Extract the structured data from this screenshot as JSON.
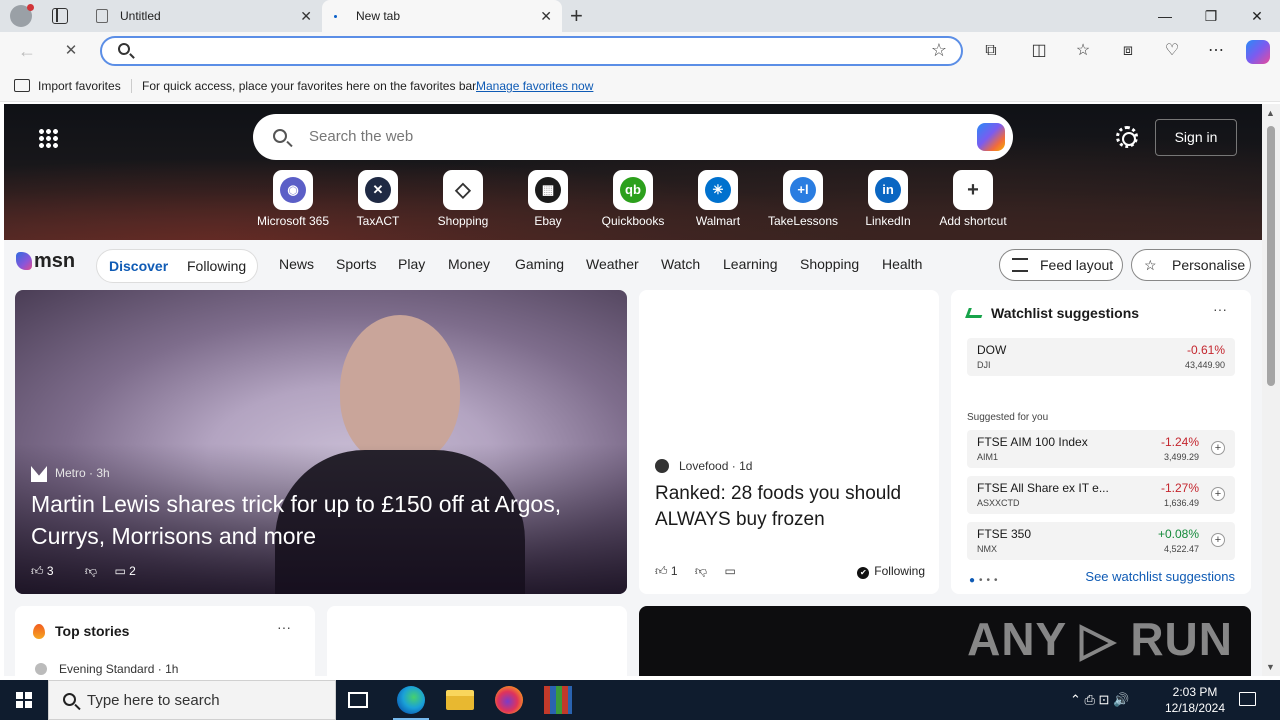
{
  "browser": {
    "tabs": [
      {
        "title": "Untitled"
      },
      {
        "title": "New tab"
      }
    ],
    "new_tab_glyph": "+",
    "close_glyph": "✕",
    "window_controls": {
      "minimize": "—",
      "restore": "❐",
      "close": "✕"
    },
    "address_value": "",
    "nav": {
      "back": "←",
      "stop": "✕"
    },
    "toolbar_icons": [
      "extensions-icon",
      "split-screen-icon",
      "favorites-icon",
      "collections-icon",
      "browser-essentials-icon",
      "more-icon",
      "copilot-icon"
    ],
    "toolbar_glyphs": {
      "extensions": "⧉",
      "split": "◫",
      "favorites": "☆",
      "collections": "⧈",
      "essentials": "♡",
      "more": "⋯",
      "star": "☆"
    }
  },
  "favorites_bar": {
    "import_label": "Import favorites",
    "message": "For quick access, place your favorites here on the favorites bar.",
    "manage_link": "Manage favorites now"
  },
  "newtab": {
    "search_placeholder": "Search the web",
    "sign_in": "Sign in",
    "shortcuts": [
      {
        "label": "Microsoft 365",
        "glyph": "◉",
        "color": "#5b5fc7"
      },
      {
        "label": "TaxACT",
        "glyph": "✕",
        "color": "#1f2a44"
      },
      {
        "label": "Shopping",
        "glyph": "◇",
        "color": "#ffffff"
      },
      {
        "label": "Ebay",
        "glyph": "▦",
        "color": "#1b1b1b"
      },
      {
        "label": "Quickbooks",
        "glyph": "qb",
        "color": "#2ca01c"
      },
      {
        "label": "Walmart",
        "glyph": "✳",
        "color": "#0071ce"
      },
      {
        "label": "TakeLessons",
        "glyph": "+l",
        "color": "#2a7de1"
      },
      {
        "label": "LinkedIn",
        "glyph": "in",
        "color": "#0a66c2"
      },
      {
        "label": "Add shortcut",
        "glyph": "+",
        "color": "#ffffff"
      }
    ],
    "brand": "msn",
    "feed_tabs": {
      "discover": "Discover",
      "following": "Following"
    },
    "categories": [
      "News",
      "Sports",
      "Play",
      "Money",
      "Gaming",
      "Weather",
      "Watch",
      "Learning",
      "Shopping",
      "Health"
    ],
    "feed_layout": "Feed layout",
    "personalise": "Personalise"
  },
  "lead_story": {
    "source": "Metro",
    "age": "3h",
    "headline": "Martin Lewis shares trick for up to £150 off at Argos, Currys, Morrisons and more",
    "likes": "3",
    "comments": "2"
  },
  "mid_story": {
    "source": "Lovefood",
    "age": "1d",
    "headline": "Ranked: 28 foods you should ALWAYS buy frozen",
    "likes": "1",
    "following": "Following"
  },
  "watchlist": {
    "title": "Watchlist suggestions",
    "more": "···",
    "primary": {
      "name": "DOW",
      "symbol": "DJI",
      "change": "-0.61%",
      "price": "43,449.90",
      "color": "#c4262e"
    },
    "suggested_label": "Suggested for you",
    "suggested": [
      {
        "name": "FTSE AIM 100 Index",
        "symbol": "AIM1",
        "change": "-1.24%",
        "price": "3,499.29",
        "color": "#c4262e"
      },
      {
        "name": "FTSE All Share ex IT e...",
        "symbol": "ASXXCTD",
        "change": "-1.27%",
        "price": "1,636.49",
        "color": "#c4262e"
      },
      {
        "name": "FTSE 350",
        "symbol": "NMX",
        "change": "+0.08%",
        "price": "4,522.47",
        "color": "#148a3a"
      }
    ],
    "see_all": "See watchlist suggestions"
  },
  "top_stories": {
    "title": "Top stories",
    "more": "···",
    "first_source": "Evening Standard",
    "first_age": "1h"
  },
  "video_card": {
    "watermark": "ANY ▷ RUN"
  },
  "taskbar": {
    "search_placeholder": "Type here to search",
    "time": "2:03 PM",
    "date": "12/18/2024",
    "tray_glyphs": "⌃  ⎙  ⊡  🔊"
  }
}
